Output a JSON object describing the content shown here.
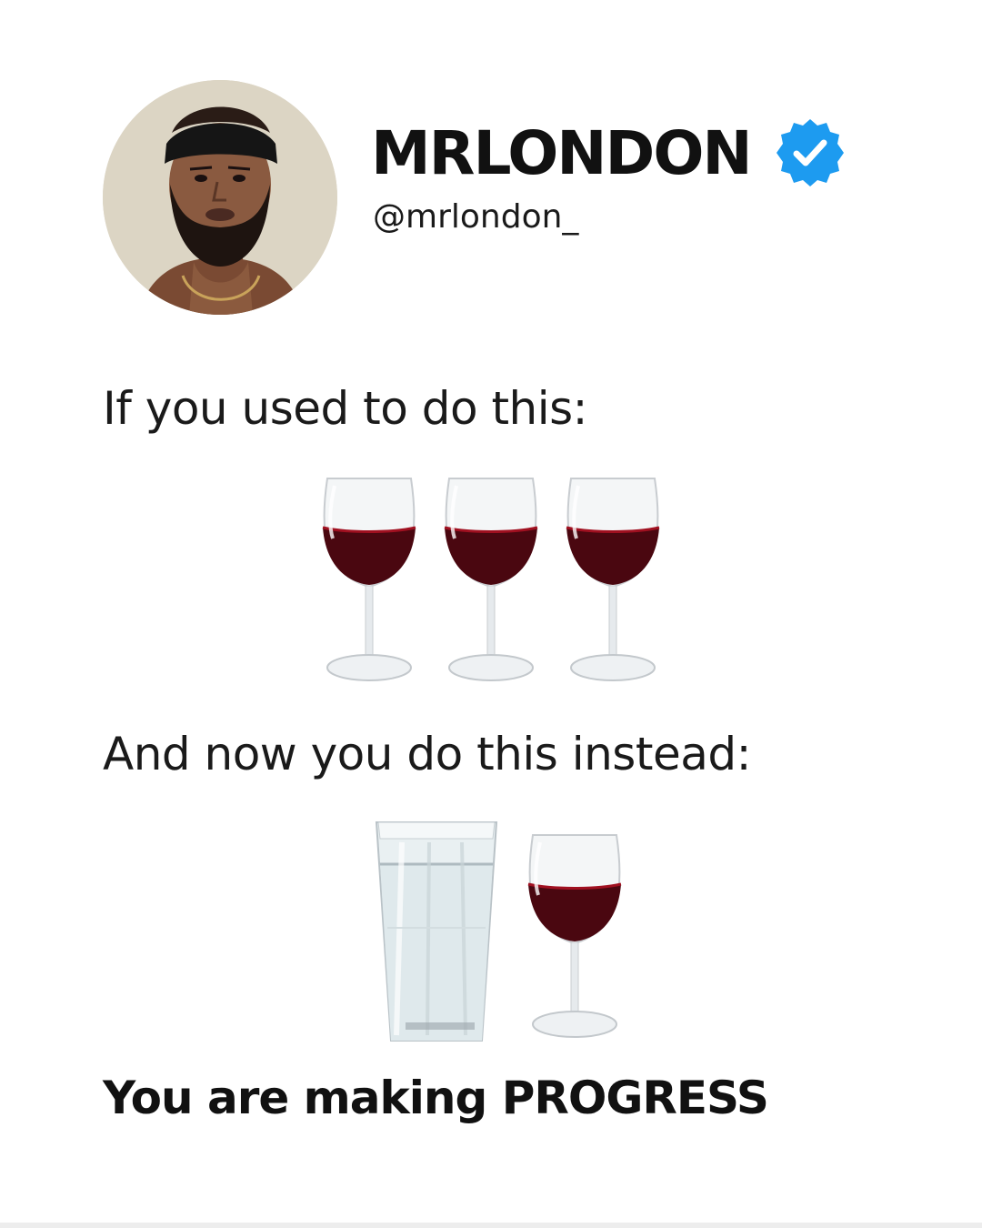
{
  "profile": {
    "display_name": "MRLONDON",
    "handle": "@mrlondon_",
    "verified": true,
    "verified_color": "#1d9bf0",
    "avatar_icon": "profile-photo"
  },
  "post": {
    "line_1": "If you used to do this:",
    "before_glasses": [
      "wine-glass",
      "wine-glass",
      "wine-glass"
    ],
    "line_2": "And now you do this instead:",
    "after_glasses": [
      "water-glass",
      "wine-glass"
    ],
    "line_3": "You are making PROGRESS"
  },
  "colors": {
    "wine": "#4a0710",
    "wine_rim": "#a01020",
    "background": "#ffffff"
  }
}
